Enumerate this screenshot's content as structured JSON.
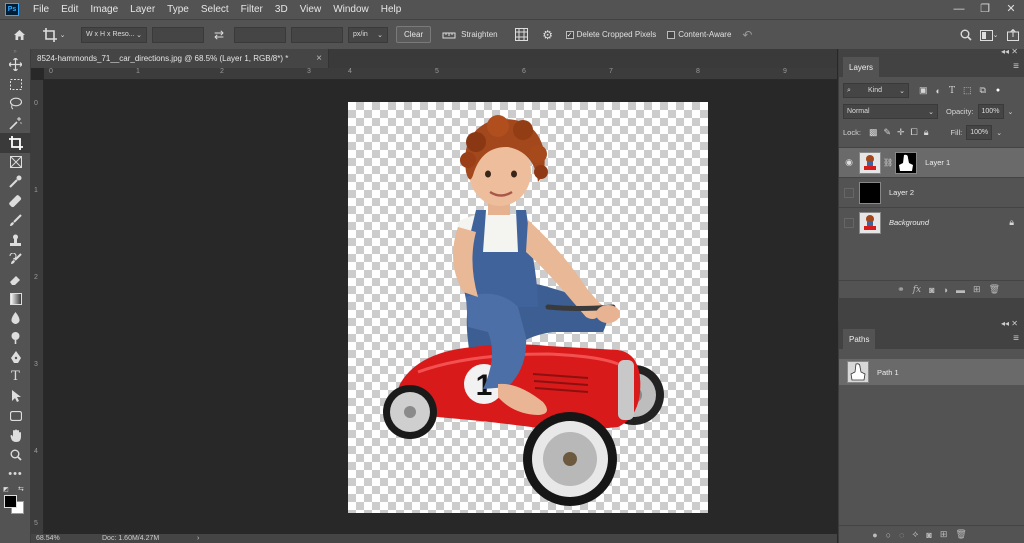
{
  "menubar": {
    "logo": "Ps",
    "items": [
      "File",
      "Edit",
      "Image",
      "Layer",
      "Type",
      "Select",
      "Filter",
      "3D",
      "View",
      "Window",
      "Help"
    ],
    "controls": {
      "minimize": "—",
      "restore": "❐",
      "close": "✕"
    }
  },
  "options_bar": {
    "ratio_select": "W x H x Reso...",
    "unit_select": "px/in",
    "clear_label": "Clear",
    "straighten_label": "Straighten",
    "delete_cropped_label": "Delete Cropped Pixels",
    "delete_cropped_checked": true,
    "content_aware_label": "Content-Aware",
    "content_aware_checked": false
  },
  "document": {
    "tab_title": "8524-hammonds_71__car_directions.jpg @ 68.5% (Layer 1, RGB/8*) *",
    "tab_close": "×",
    "ruler_top": [
      "0",
      "1",
      "2",
      "3",
      "4",
      "5",
      "6",
      "7",
      "8",
      "9"
    ],
    "ruler_left": [
      "0",
      "1",
      "2",
      "3",
      "4",
      "5"
    ]
  },
  "canvas": {
    "car_number": "1"
  },
  "status": {
    "zoom": "68.54%",
    "doc": "Doc: 1.60M/4.27M",
    "arrow": "›"
  },
  "layers_panel": {
    "tab": "Layers",
    "kind_label": "Kind",
    "blend_mode": "Normal",
    "opacity_label": "Opacity:",
    "opacity_value": "100%",
    "lock_label": "Lock:",
    "fill_label": "Fill:",
    "fill_value": "100%",
    "layers": [
      {
        "name": "Layer 1",
        "visible": true,
        "selected": true
      },
      {
        "name": "Layer 2",
        "visible": false,
        "selected": false
      },
      {
        "name": "Background",
        "visible": false,
        "selected": false,
        "locked": true
      }
    ]
  },
  "paths_panel": {
    "tab": "Paths",
    "paths": [
      {
        "name": "Path 1"
      }
    ]
  },
  "colors": {
    "bg": "#282828",
    "panel": "#535353",
    "car_red": "#d81a1a"
  }
}
